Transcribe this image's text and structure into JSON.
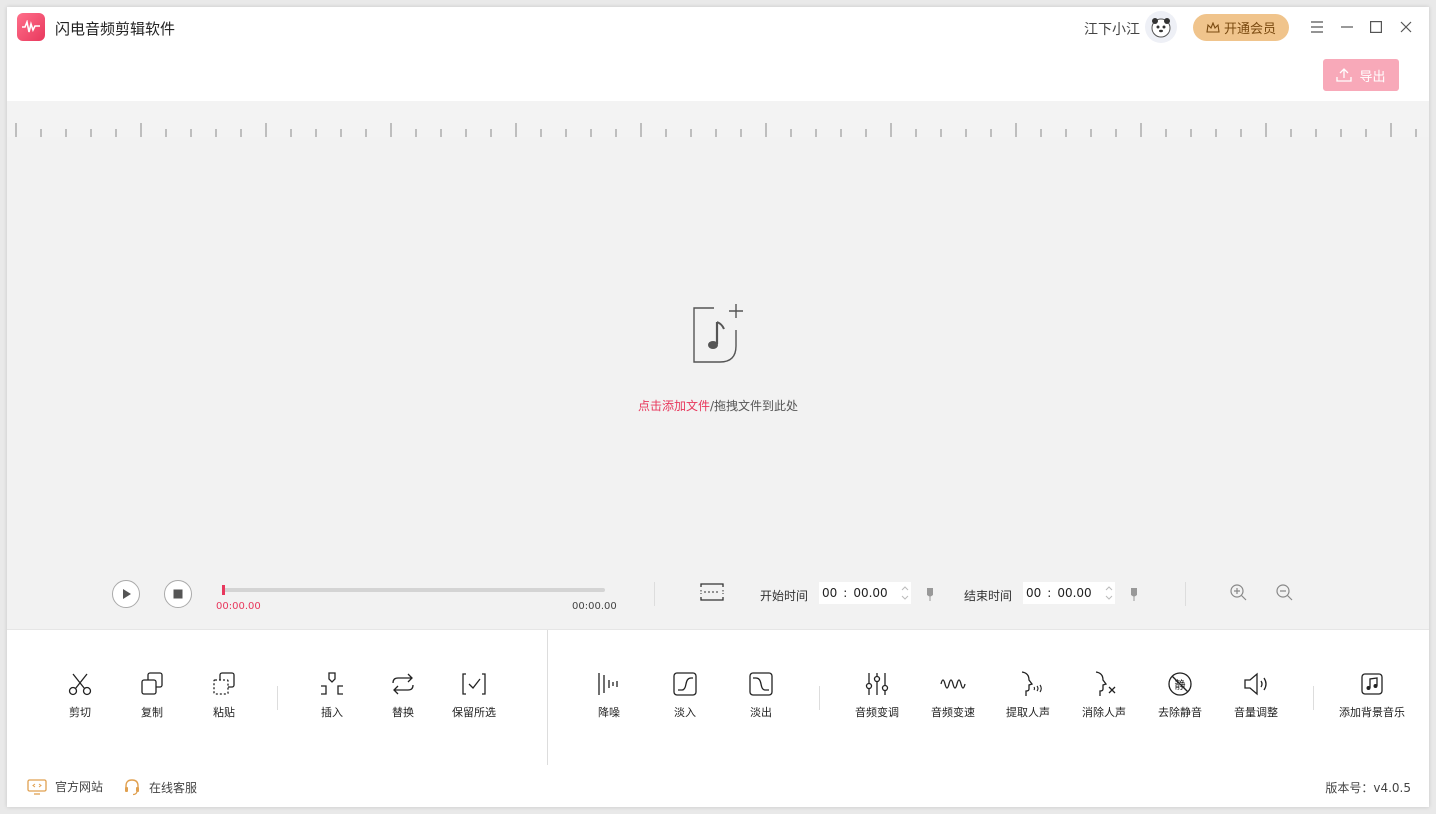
{
  "app": {
    "title": "闪电音频剪辑软件",
    "user_name": "江下小江",
    "vip_label": "开通会员",
    "export_label": "导出"
  },
  "canvas": {
    "add_link": "点击添加文件",
    "add_rest": "/拖拽文件到此处"
  },
  "player": {
    "current_time": "00:00.00",
    "total_time": "00:00.00",
    "progress_fraction": 0
  },
  "range": {
    "start_label": "开始时间",
    "start_min": "00",
    "start_sec": "00.00",
    "end_label": "结束时间",
    "end_min": "00",
    "end_sec": "00.00"
  },
  "tools": {
    "cut": "剪切",
    "copy": "复制",
    "paste": "粘贴",
    "insert": "插入",
    "replace": "替换",
    "keep": "保留所选",
    "denoise": "降噪",
    "fade_in": "淡入",
    "fade_out": "淡出",
    "pitch": "音频变调",
    "speed": "音频变速",
    "extract_voice": "提取人声",
    "remove_voice": "消除人声",
    "remove_silence": "去除静音",
    "volume": "音量调整",
    "bgm": "添加背景音乐"
  },
  "footer": {
    "website": "官方网站",
    "support": "在线客服",
    "version_label": "版本号：",
    "version_value": "v4.0.5"
  },
  "colors": {
    "accent": "#e8385d",
    "vip": "#f0c48c",
    "export": "#f8a9b9"
  }
}
